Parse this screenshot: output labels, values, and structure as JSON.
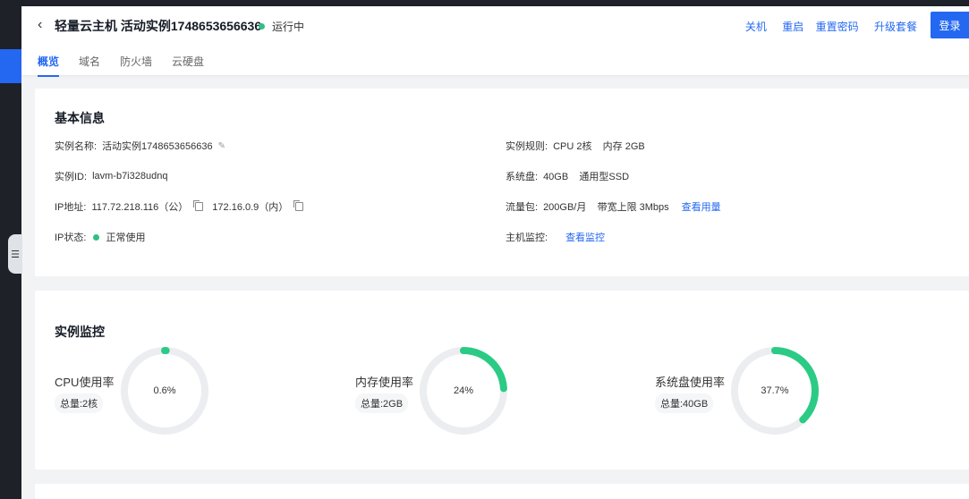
{
  "header": {
    "back_icon": "‹",
    "title": "轻量云主机 活动实例1748653656636",
    "status": "运行中",
    "status_color": "#30bf84",
    "actions": [
      "关机",
      "重启",
      "重置密码",
      "升级套餐"
    ],
    "login": "登录"
  },
  "tabs": [
    "概览",
    "域名",
    "防火墙",
    "云硬盘"
  ],
  "basic": {
    "title": "基本信息",
    "instance_name_label": "实例名称:",
    "instance_name": "活动实例1748653656636",
    "instance_id_label": "实例ID:",
    "instance_id": "lavm-b7i328udnq",
    "ip_label": "IP地址:",
    "ip_public": "117.72.218.116（公）",
    "ip_private": "172.16.0.9（内）",
    "ip_status_label": "IP状态:",
    "ip_status": "正常使用",
    "spec_label": "实例规则:",
    "spec": "CPU 2核    内存 2GB",
    "disk_label": "系统盘:",
    "disk": "40GB    通用型SSD",
    "traffic_label": "流量包:",
    "traffic": "200GB/月    带宽上限 3Mbps",
    "traffic_link": "查看用量",
    "monitor_label": "主机监控:",
    "monitor_link": "查看监控"
  },
  "monitor": {
    "title": "实例监控",
    "accent": "#2bcb85",
    "track": "#ebedf0",
    "items": [
      {
        "name": "CPU使用率",
        "total": "总量:2核",
        "value": "0.6%",
        "fraction": 0.006
      },
      {
        "name": "内存使用率",
        "total": "总量:2GB",
        "value": "24%",
        "fraction": 0.24
      },
      {
        "name": "系统盘使用率",
        "total": "总量:40GB",
        "value": "37.7%",
        "fraction": 0.377
      }
    ]
  }
}
